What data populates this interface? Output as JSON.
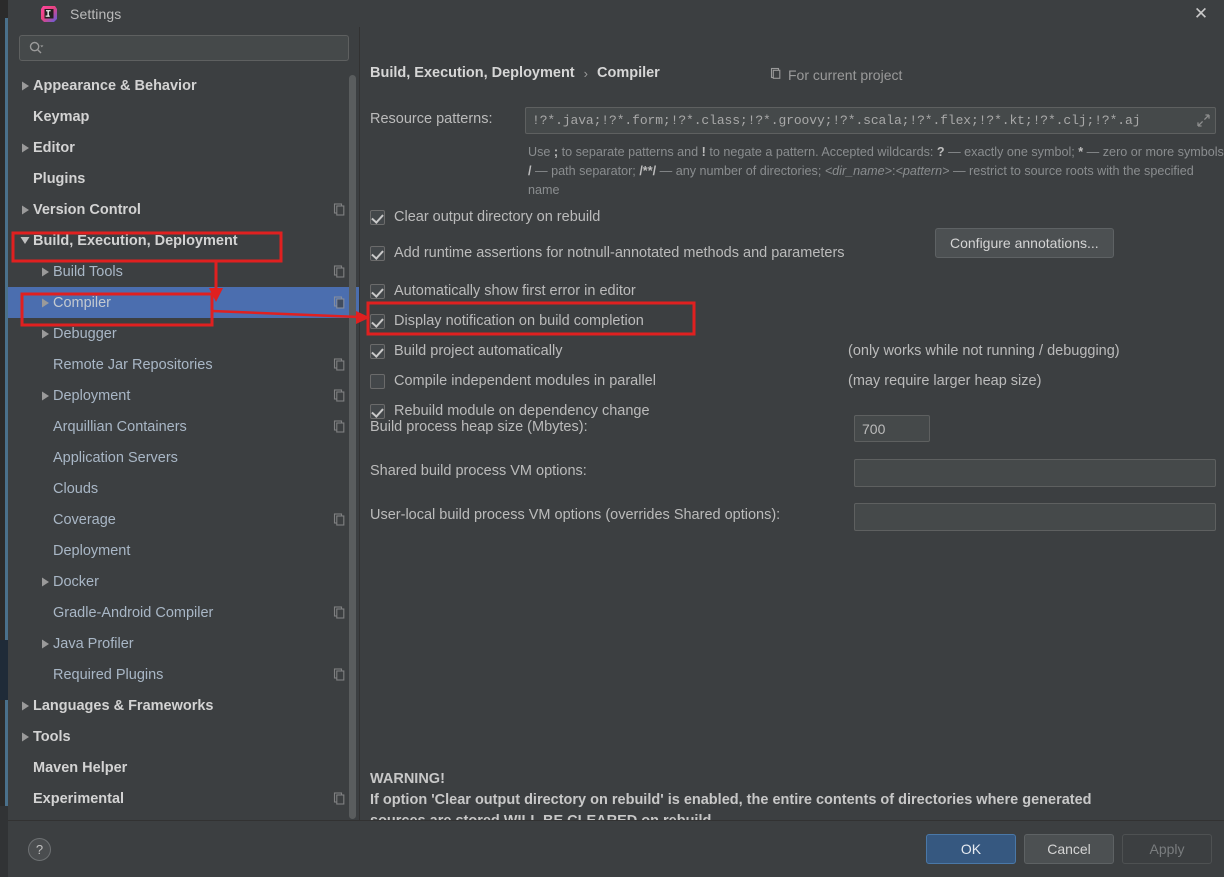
{
  "window": {
    "title": "Settings",
    "logo_icon": "intellij-idea-logo",
    "close_icon": "close-icon"
  },
  "sidebar": {
    "search": {
      "placeholder": "",
      "value": "",
      "icon": "search-icon",
      "dropdown_icon": "chevron-down-icon"
    },
    "items": [
      {
        "label": "Appearance & Behavior",
        "level": 0,
        "arrow": "right",
        "bold": true,
        "badge": false,
        "selected": false
      },
      {
        "label": "Keymap",
        "level": 0,
        "arrow": "none",
        "bold": true,
        "badge": false,
        "selected": false
      },
      {
        "label": "Editor",
        "level": 0,
        "arrow": "right",
        "bold": true,
        "badge": false,
        "selected": false
      },
      {
        "label": "Plugins",
        "level": 0,
        "arrow": "none",
        "bold": true,
        "badge": false,
        "selected": false
      },
      {
        "label": "Version Control",
        "level": 0,
        "arrow": "right",
        "bold": true,
        "badge": true,
        "selected": false
      },
      {
        "label": "Build, Execution, Deployment",
        "level": 0,
        "arrow": "down",
        "bold": true,
        "badge": false,
        "selected": false
      },
      {
        "label": "Build Tools",
        "level": 1,
        "arrow": "right",
        "bold": false,
        "badge": true,
        "selected": false
      },
      {
        "label": "Compiler",
        "level": 1,
        "arrow": "right",
        "bold": false,
        "badge": true,
        "selected": true
      },
      {
        "label": "Debugger",
        "level": 1,
        "arrow": "right",
        "bold": false,
        "badge": false,
        "selected": false
      },
      {
        "label": "Remote Jar Repositories",
        "level": 1,
        "arrow": "none",
        "bold": false,
        "badge": true,
        "selected": false
      },
      {
        "label": "Deployment",
        "level": 1,
        "arrow": "right",
        "bold": false,
        "badge": true,
        "selected": false
      },
      {
        "label": "Arquillian Containers",
        "level": 1,
        "arrow": "none",
        "bold": false,
        "badge": true,
        "selected": false
      },
      {
        "label": "Application Servers",
        "level": 1,
        "arrow": "none",
        "bold": false,
        "badge": false,
        "selected": false
      },
      {
        "label": "Clouds",
        "level": 1,
        "arrow": "none",
        "bold": false,
        "badge": false,
        "selected": false
      },
      {
        "label": "Coverage",
        "level": 1,
        "arrow": "none",
        "bold": false,
        "badge": true,
        "selected": false
      },
      {
        "label": "Deployment",
        "level": 1,
        "arrow": "none",
        "bold": false,
        "badge": false,
        "selected": false
      },
      {
        "label": "Docker",
        "level": 1,
        "arrow": "right",
        "bold": false,
        "badge": false,
        "selected": false
      },
      {
        "label": "Gradle-Android Compiler",
        "level": 1,
        "arrow": "none",
        "bold": false,
        "badge": true,
        "selected": false
      },
      {
        "label": "Java Profiler",
        "level": 1,
        "arrow": "right",
        "bold": false,
        "badge": false,
        "selected": false
      },
      {
        "label": "Required Plugins",
        "level": 1,
        "arrow": "none",
        "bold": false,
        "badge": true,
        "selected": false
      },
      {
        "label": "Languages & Frameworks",
        "level": 0,
        "arrow": "right",
        "bold": true,
        "badge": false,
        "selected": false
      },
      {
        "label": "Tools",
        "level": 0,
        "arrow": "right",
        "bold": true,
        "badge": false,
        "selected": false
      },
      {
        "label": "Maven Helper",
        "level": 0,
        "arrow": "none",
        "bold": true,
        "badge": false,
        "selected": false
      },
      {
        "label": "Experimental",
        "level": 0,
        "arrow": "none",
        "bold": true,
        "badge": true,
        "selected": false
      }
    ]
  },
  "main": {
    "breadcrumb": {
      "parent": "Build, Execution, Deployment",
      "separator": "›",
      "current": "Compiler"
    },
    "scope_note": {
      "icon": "project-scope-icon",
      "label": "For current project"
    },
    "resource_patterns": {
      "label": "Resource patterns:",
      "value": "!?*.java;!?*.form;!?*.class;!?*.groovy;!?*.scala;!?*.flex;!?*.kt;!?*.clj;!?*.aj",
      "expand_icon": "expand-icon"
    },
    "hint_html": "Use <b>;</b> to separate patterns and <b>!</b> to negate a pattern. Accepted wildcards: <b>?</b> — exactly one symbol; <b>*</b> — zero or more symbols; <b>/</b> — path separator; <b>/**/</b> — any number of directories; <i>&lt;dir_name&gt;</i>:<i>&lt;pattern&gt;</i> — restrict to source roots with the specified name",
    "checkboxes": [
      {
        "label": "Clear output directory on rebuild",
        "checked": true,
        "mnemonic": "l",
        "aside": ""
      },
      {
        "label": "Add runtime assertions for notnull-annotated methods and parameters",
        "checked": true,
        "mnemonic": "a",
        "aside": ""
      },
      {
        "label": "Automatically show first error in editor",
        "checked": true,
        "mnemonic": "e",
        "aside": ""
      },
      {
        "label": "Display notification on build completion",
        "checked": true,
        "mnemonic": "",
        "aside": ""
      },
      {
        "label": "Build project automatically",
        "checked": true,
        "mnemonic": "",
        "aside": "(only works while not running / debugging)"
      },
      {
        "label": "Compile independent modules in parallel",
        "checked": false,
        "mnemonic": "",
        "aside": "(may require larger heap size)"
      },
      {
        "label": "Rebuild module on dependency change",
        "checked": true,
        "mnemonic": "",
        "aside": ""
      }
    ],
    "configure_annotations_button": "Configure annotations...",
    "fields": [
      {
        "label": "Build process heap size (Mbytes):",
        "value": "700",
        "placeholder": "",
        "kind": "small"
      },
      {
        "label": "Shared build process VM options:",
        "value": "",
        "placeholder": "",
        "kind": "wide"
      },
      {
        "label": "User-local build process VM options (overrides Shared options):",
        "value": "",
        "placeholder": "",
        "kind": "wide"
      }
    ],
    "warning": {
      "heading": "WARNING!",
      "line1": "If option 'Clear output directory on rebuild' is enabled, the entire contents of directories where generated",
      "line2": "sources are stored WILL BE CLEARED on rebuild."
    }
  },
  "footer": {
    "help_label": "?",
    "ok_label": "OK",
    "cancel_label": "Cancel",
    "apply_label": "Apply"
  },
  "annotations": {
    "color": "#e02020",
    "boxes": [
      "build-execution-deployment-row",
      "compiler-row",
      "build-project-automatically-row"
    ],
    "arrows": [
      "down-arrow-to-compiler",
      "right-arrow-to-build-project-automatically"
    ]
  },
  "colors": {
    "accent_selection": "#4b6eaf",
    "ok_button": "#365880",
    "annotation_red": "#e02020",
    "panel_bg": "#3c3f41",
    "field_bg": "#45494a"
  }
}
